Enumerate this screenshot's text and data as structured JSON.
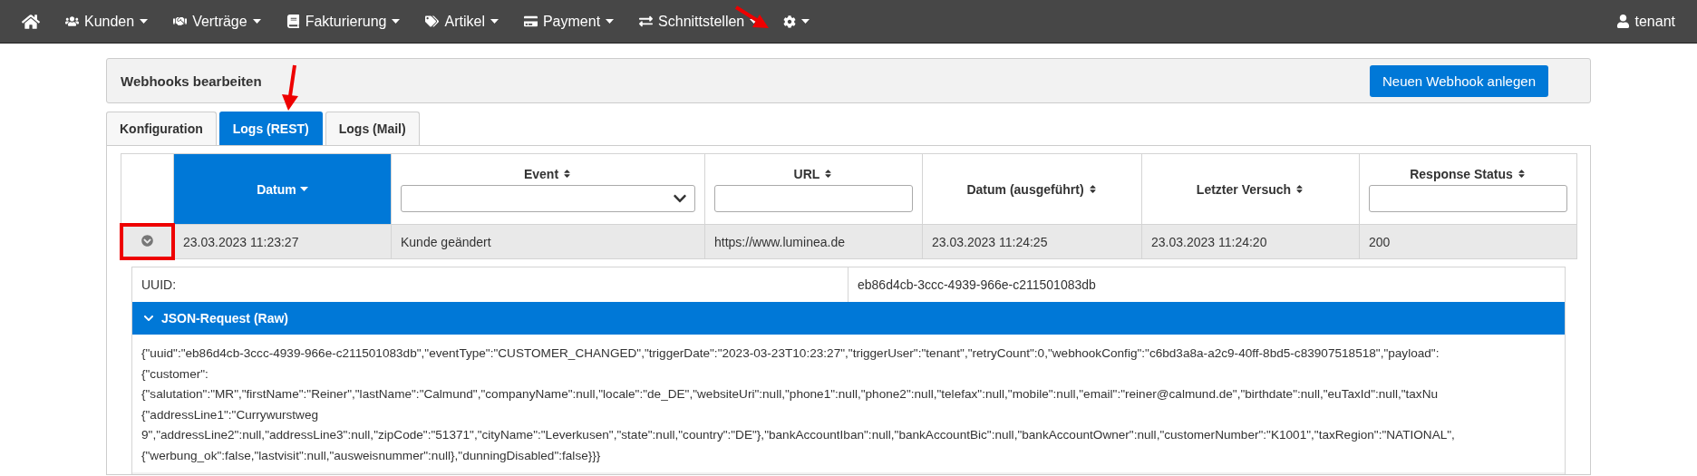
{
  "navbar": {
    "items": [
      {
        "kind": "home"
      },
      {
        "kind": "menu",
        "label": "Kunden"
      },
      {
        "kind": "menu",
        "label": "Verträge"
      },
      {
        "kind": "menu",
        "label": "Fakturierung"
      },
      {
        "kind": "menu",
        "label": "Artikel"
      },
      {
        "kind": "menu",
        "label": "Payment"
      },
      {
        "kind": "menu",
        "label": "Schnittstellen"
      },
      {
        "kind": "settings"
      }
    ],
    "user": "tenant"
  },
  "header": {
    "title": "Webhooks bearbeiten",
    "button": "Neuen Webhook anlegen"
  },
  "tabs": [
    {
      "label": "Konfiguration",
      "selected": false
    },
    {
      "label": "Logs (REST)",
      "selected": true
    },
    {
      "label": "Logs (Mail)",
      "selected": false
    }
  ],
  "table": {
    "columns": [
      {
        "label": "Datum",
        "selected": true
      },
      {
        "label": "Event",
        "selected": false
      },
      {
        "label": "URL",
        "selected": false
      },
      {
        "label": "Datum (ausgeführt)",
        "selected": false
      },
      {
        "label": "Letzter Versuch",
        "selected": false
      },
      {
        "label": "Response Status",
        "selected": false
      }
    ],
    "rows": [
      {
        "expanded": true,
        "cells": [
          "23.03.2023 11:23:27",
          "Kunde geändert",
          "https://www.luminea.de",
          "23.03.2023 11:24:25",
          "23.03.2023 11:24:20",
          "200"
        ]
      }
    ]
  },
  "detail": {
    "uuid_label": "UUID:",
    "uuid_value": "eb86d4cb-3ccc-4939-966e-c211501083db",
    "section_title": "JSON-Request (Raw)",
    "section_expanded": true,
    "json_lines": [
      "{\"uuid\":\"eb86d4cb-3ccc-4939-966e-c211501083db\",\"eventType\":\"CUSTOMER_CHANGED\",\"triggerDate\":\"2023-03-23T10:23:27\",\"triggerUser\":\"tenant\",\"retryCount\":0,\"webhookConfig\":\"c6bd3a8a-a2c9-40ff-8bd5-c83907518518\",\"payload\":",
      "{\"customer\":",
      "{\"salutation\":\"MR\",\"firstName\":\"Reiner\",\"lastName\":\"Calmund\",\"companyName\":null,\"locale\":\"de_DE\",\"websiteUri\":null,\"phone1\":null,\"phone2\":null,\"telefax\":null,\"mobile\":null,\"email\":\"reiner@calmund.de\",\"birthdate\":null,\"euTaxId\":null,\"taxNu",
      "{\"addressLine1\":\"Currywurstweg",
      "9\",\"addressLine2\":null,\"addressLine3\":null,\"zipCode\":\"51371\",\"cityName\":\"Leverkusen\",\"state\":null,\"country\":\"DE\"},\"bankAccountIban\":null,\"bankAccountBic\":null,\"bankAccountOwner\":null,\"customerNumber\":\"K1001\",\"taxRegion\":\"NATIONAL\",",
      "{\"werbung_ok\":false,\"lastvisit\":null,\"ausweisnummer\":null},\"dunningDisabled\":false}}}"
    ]
  }
}
